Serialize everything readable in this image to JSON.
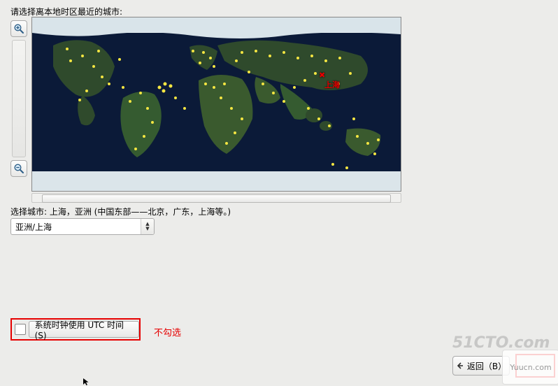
{
  "labels": {
    "prompt": "请选择离本地时区最近的城市:",
    "selected_city": "选择城市: 上海，亚洲 (中国东部——北京，广东，上海等。)"
  },
  "map": {
    "selected_marker_label": "上海",
    "selected_marker_symbol": "✖"
  },
  "timezone_select": {
    "value": "亚洲/上海"
  },
  "utc_checkbox": {
    "checked": false,
    "label": "系统时钟使用 UTC 时间(S)"
  },
  "annotation": "不勾选",
  "buttons": {
    "back": "返回（B）"
  },
  "watermarks": {
    "wm1": "51CTO.com",
    "wm2": "Yuucn.com"
  }
}
